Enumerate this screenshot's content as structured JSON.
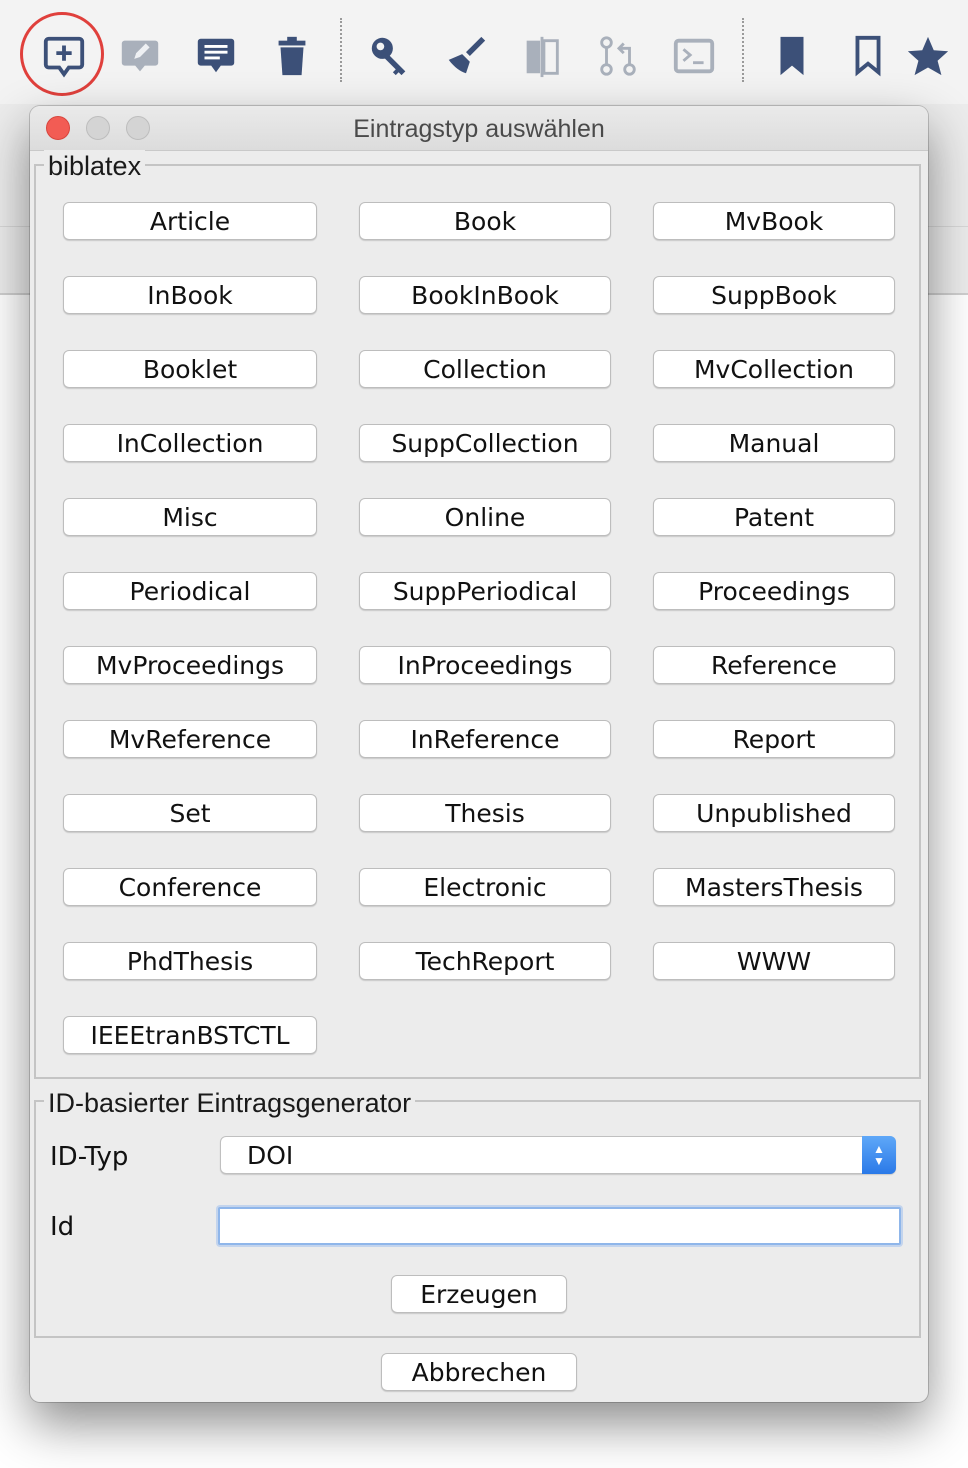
{
  "toolbar": {
    "icons": [
      {
        "name": "new-entry-icon"
      },
      {
        "name": "edit-entry-icon"
      },
      {
        "name": "notes-icon"
      },
      {
        "name": "delete-icon"
      },
      {
        "name": "key-icon"
      },
      {
        "name": "cleanup-broom-icon"
      },
      {
        "name": "merge-icon"
      },
      {
        "name": "pull-request-icon"
      },
      {
        "name": "terminal-icon"
      },
      {
        "name": "bookmark-filled-icon"
      },
      {
        "name": "bookmark-outline-icon"
      },
      {
        "name": "star-icon"
      }
    ],
    "colors": {
      "active": "#3c5078",
      "disabled": "#a9b0bb",
      "highlight": "#e0403c"
    }
  },
  "dialog": {
    "title": "Eintragstyp auswählen",
    "biblatex_group": {
      "legend": "biblatex",
      "entry_types": [
        "Article",
        "Book",
        "MvBook",
        "InBook",
        "BookInBook",
        "SuppBook",
        "Booklet",
        "Collection",
        "MvCollection",
        "InCollection",
        "SuppCollection",
        "Manual",
        "Misc",
        "Online",
        "Patent",
        "Periodical",
        "SuppPeriodical",
        "Proceedings",
        "MvProceedings",
        "InProceedings",
        "Reference",
        "MvReference",
        "InReference",
        "Report",
        "Set",
        "Thesis",
        "Unpublished",
        "Conference",
        "Electronic",
        "MastersThesis",
        "PhdThesis",
        "TechReport",
        "WWW",
        "IEEEtranBSTCTL"
      ]
    },
    "id_group": {
      "legend": "ID-basierter Eintragsgenerator",
      "id_type_label": "ID-Typ",
      "id_type_value": "DOI",
      "id_label": "Id",
      "id_value": "",
      "generate_label": "Erzeugen"
    },
    "cancel_label": "Abbrechen"
  }
}
